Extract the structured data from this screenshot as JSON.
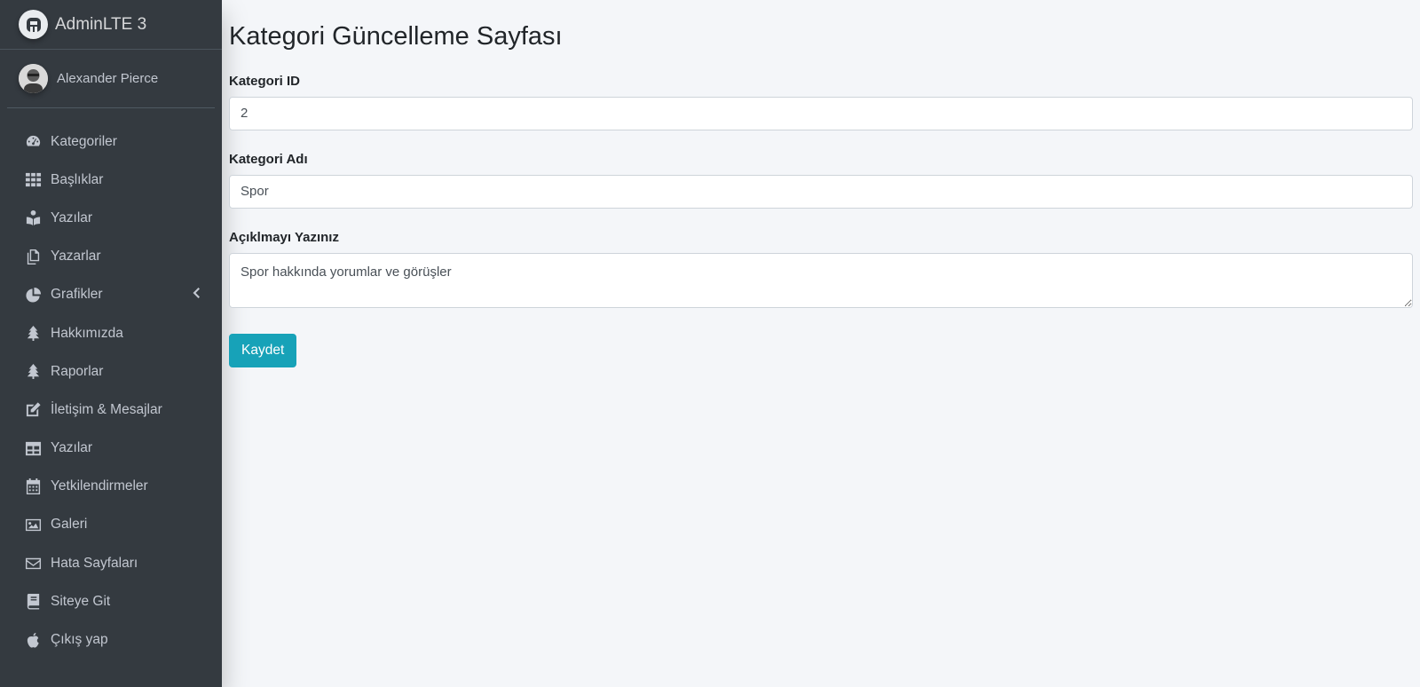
{
  "brand": {
    "name": "AdminLTE 3"
  },
  "user": {
    "name": "Alexander Pierce"
  },
  "sidebar": {
    "items": [
      {
        "label": "Kategoriler",
        "icon": "tachometer-icon"
      },
      {
        "label": "Başlıklar",
        "icon": "grid-icon"
      },
      {
        "label": "Yazılar",
        "icon": "book-reader-icon"
      },
      {
        "label": "Yazarlar",
        "icon": "copy-icon"
      },
      {
        "label": "Grafikler",
        "icon": "pie-chart-icon"
      },
      {
        "label": "Hakkımızda",
        "icon": "tree-icon"
      },
      {
        "label": "Raporlar",
        "icon": "tree-icon"
      },
      {
        "label": "İletişim & Mesajlar",
        "icon": "edit-icon"
      },
      {
        "label": "Yazılar",
        "icon": "table-icon"
      },
      {
        "label": "Yetkilendirmeler",
        "icon": "calendar-icon"
      },
      {
        "label": "Galeri",
        "icon": "image-icon"
      },
      {
        "label": "Hata Sayfaları",
        "icon": "envelope-icon"
      },
      {
        "label": "Siteye Git",
        "icon": "book-icon"
      },
      {
        "label": "Çıkış yap",
        "icon": "apple-icon"
      }
    ]
  },
  "page": {
    "title": "Kategori Güncelleme Sayfası",
    "fields": {
      "id_label": "Kategori ID",
      "id_value": "2",
      "name_label": "Kategori Adı",
      "name_value": "Spor",
      "desc_label": "Açıklmayı Yazınız",
      "desc_value": "Spor hakkında yorumlar ve görüşler"
    },
    "save_label": "Kaydet"
  },
  "colors": {
    "sidebar": "#343a40",
    "background": "#f4f6f9",
    "button": "#17a2b8"
  }
}
